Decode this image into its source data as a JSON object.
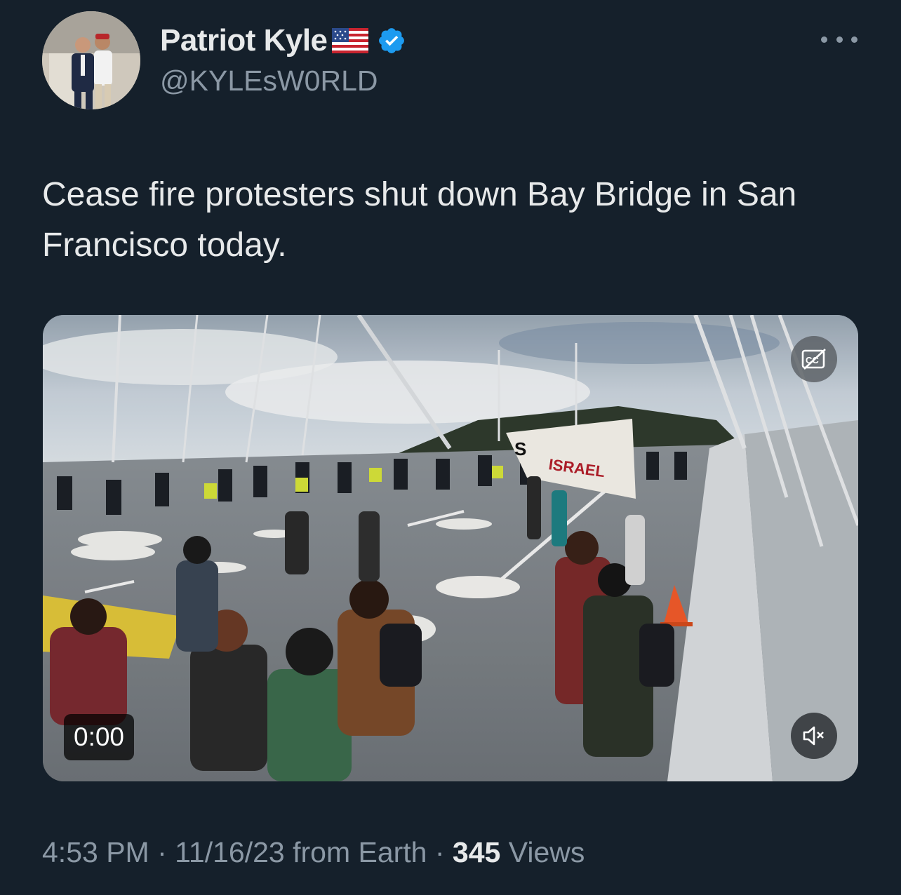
{
  "author": {
    "display_name": "Patriot Kyle",
    "handle": "@KYLEsW0RLD",
    "flag_icon": "us-flag-icon",
    "verified_icon": "verified-badge-icon",
    "verified_color": "#1d9bf0"
  },
  "tweet": {
    "text": "Cease fire protesters shut down Bay Bridge in San Francisco today."
  },
  "media": {
    "duration": "0:00",
    "banner_text": "S",
    "banner_text_2": "ISRAEL",
    "cc_icon": "closed-captions-icon",
    "mute_icon": "speaker-muted-icon"
  },
  "meta": {
    "time": "4:53 PM",
    "sep1": " · ",
    "date": "11/16/23",
    "source": " from Earth",
    "sep2": " · ",
    "views_count": "345",
    "views_label": " Views"
  },
  "colors": {
    "background": "#15202b",
    "text_primary": "#e7e9ea",
    "text_secondary": "#8b98a5"
  }
}
